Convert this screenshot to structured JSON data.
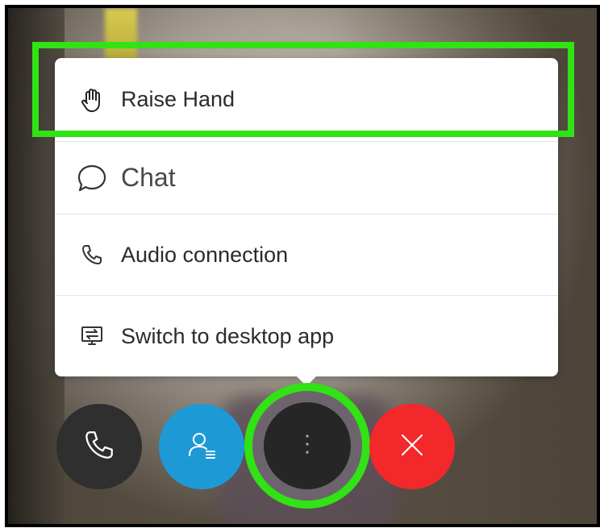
{
  "menu": {
    "items": [
      {
        "label": "Raise Hand",
        "icon": "hand-icon"
      },
      {
        "label": "Chat",
        "icon": "chat-bubble-icon"
      },
      {
        "label": "Audio connection",
        "icon": "phone-icon"
      },
      {
        "label": "Switch to desktop app",
        "icon": "desktop-switch-icon"
      }
    ]
  },
  "controls": {
    "phone": {
      "icon": "phone-icon",
      "color": "#2f2f2f"
    },
    "participants": {
      "icon": "participants-icon",
      "color": "#1d9ad6"
    },
    "more": {
      "icon": "more-vertical-icon",
      "color": "#262626"
    },
    "end": {
      "icon": "close-icon",
      "color": "#f2282b"
    }
  },
  "highlight_color": "#31e214"
}
